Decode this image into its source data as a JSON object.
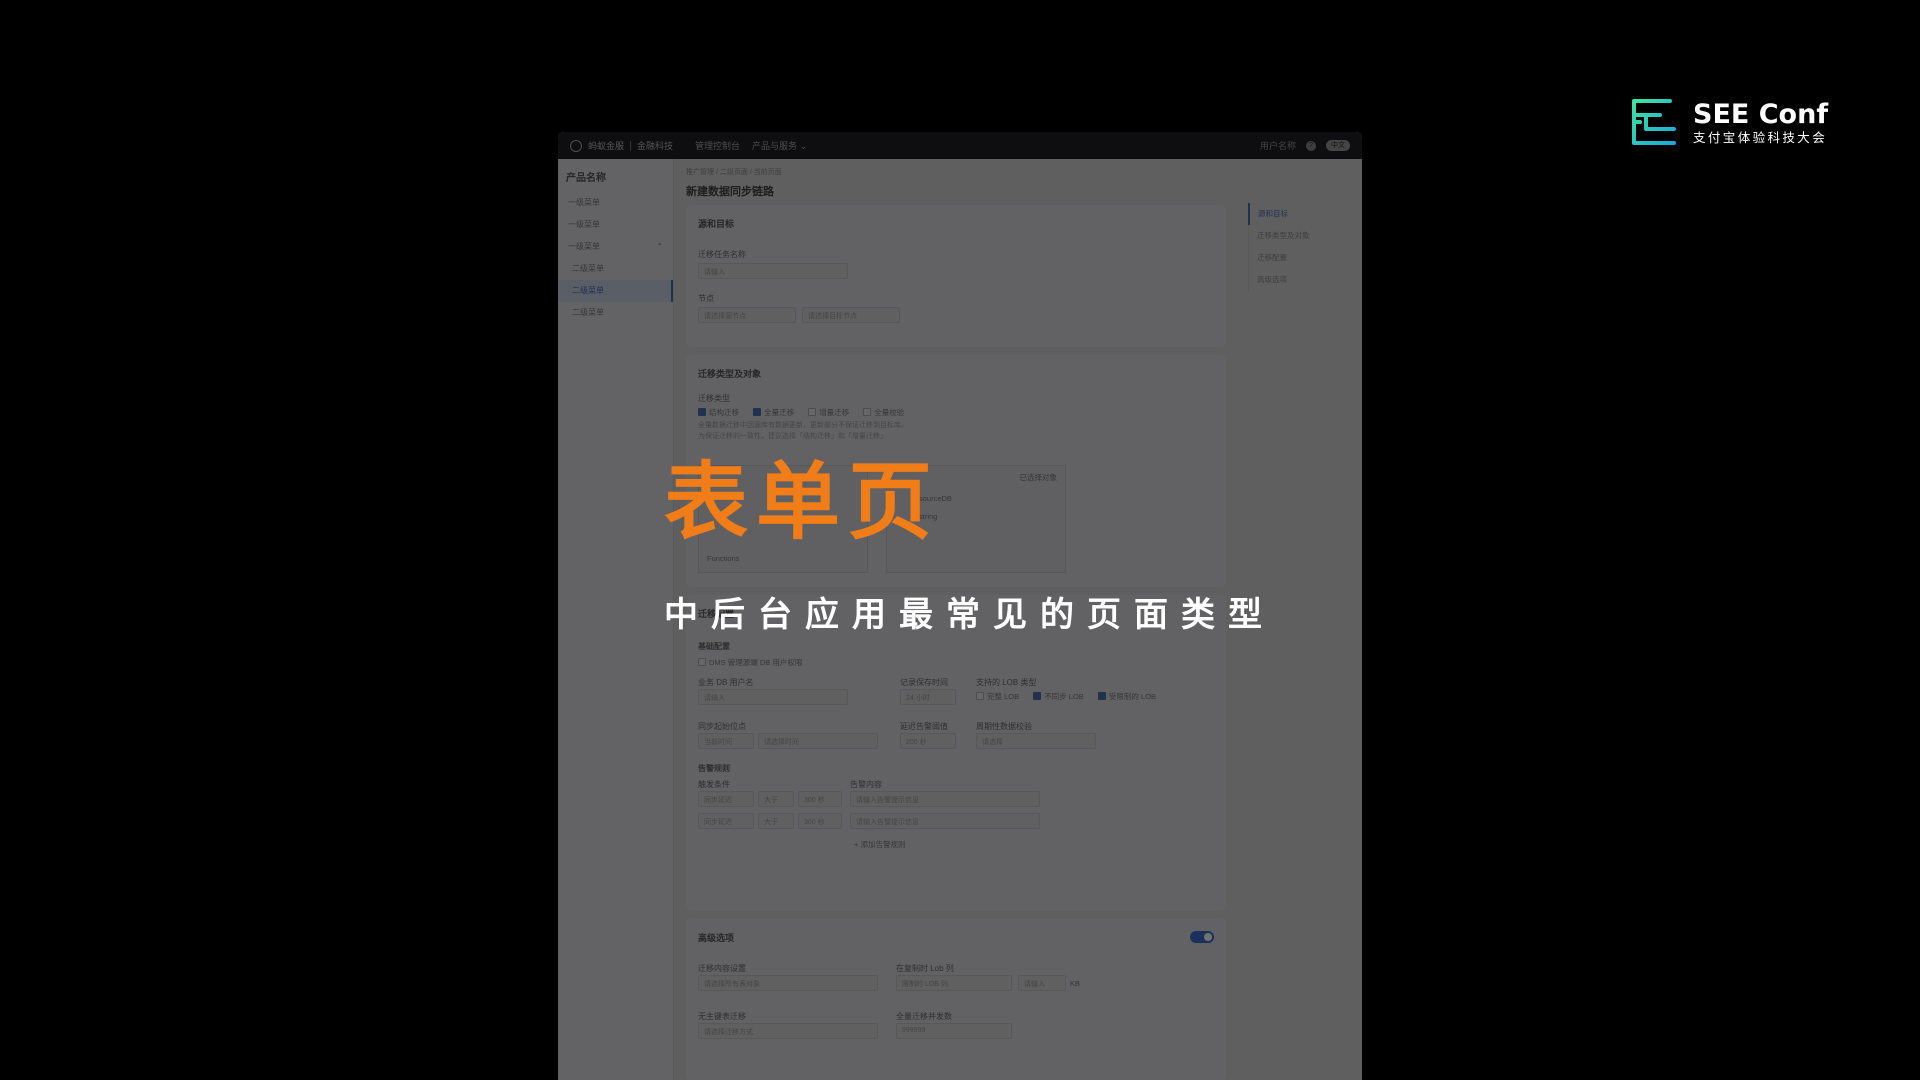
{
  "logo": {
    "title": "SEE Conf",
    "subtitle": "支付宝体验科技大会",
    "mark_color": "#1fd0c1"
  },
  "headline": {
    "title": "表单页",
    "subtitle": "中后台应用最常见的页面类型",
    "title_color": "#f07d17"
  },
  "app": {
    "topbar": {
      "brand_left": "蚂蚁金服",
      "brand_right": "金融科技",
      "nav": [
        "管理控制台",
        "产品与服务"
      ],
      "user": "用户名称",
      "lang": "中文"
    },
    "sidebar": {
      "title": "产品名称",
      "items": [
        {
          "label": "一级菜单"
        },
        {
          "label": "一级菜单"
        },
        {
          "label": "一级菜单"
        },
        {
          "label": "二级菜单"
        },
        {
          "label": "二级菜单"
        },
        {
          "label": "二级菜单"
        }
      ]
    },
    "breadcrumb": "推广管理 / 二级页面 / 当前页面",
    "page_title": "新建数据同步链路",
    "anchors": [
      "源和目标",
      "迁移类型及对象",
      "迁移配置",
      "高级选项"
    ],
    "section_source": {
      "title": "源和目标",
      "task_name_label": "迁移任务名称",
      "task_name_placeholder": "请输入",
      "node_label": "节点",
      "node_placeholder_1": "请选择源节点",
      "node_placeholder_2": "请选择目标节点"
    },
    "section_type": {
      "title": "迁移类型及对象",
      "type_label": "迁移类型",
      "options": [
        "结构迁移",
        "全量迁移",
        "增量迁移",
        "全量校验"
      ],
      "hint_1": "全量数据迁移中因源库有数据更新，更新部分不保证迁移到目标库。",
      "hint_2": "为保证迁移的一致性，建议选择「结构迁移」和「增量迁移」",
      "selected_label": "已选择对象",
      "list_items": [
        "sourceDB",
        "string",
        "Functions"
      ]
    },
    "section_config": {
      "title": "迁移配置",
      "basic_title": "基础配置",
      "dms_label": "DMS 管理源端 DB 用户权限",
      "db_user_label": "业务 DB 用户名",
      "db_user_placeholder": "请输入",
      "log_time_label": "记录保存时间",
      "log_time_value": "24 小时",
      "lob_label": "支持的 LOB 类型",
      "lob_options": [
        "完整 LOB",
        "不同步 LOB",
        "受限制的 LOB"
      ],
      "sync_start_label": "同步起始位点",
      "sync_start_value": "当前时间",
      "sync_start_placeholder": "请选择时间",
      "delay_label": "延迟告警阈值",
      "delay_value": "200 秒",
      "period_label": "周期性数据校验",
      "period_placeholder": "请选择",
      "alarm_title": "告警规则",
      "trigger_label": "触发条件",
      "content_label": "告警内容",
      "rule_metric": "同步延迟",
      "rule_op": "大于",
      "rule_value": "300 秒",
      "rule_content_placeholder": "请输入告警提示信息",
      "add_rule": "+ 添加告警规则"
    },
    "section_advanced": {
      "title": "高级选项",
      "content_label": "迁移内容设置",
      "content_placeholder": "请选择所有表对象",
      "lob_col_label": "在复制时 Lob 列",
      "lob_col_value": "限制的 LOB 列",
      "lob_size_placeholder": "请输入",
      "lob_unit": "KB",
      "nopk_label": "无主键表迁移",
      "nopk_placeholder": "请选择迁移方式",
      "concurrency_label": "全量迁移并发数",
      "concurrency_value": "999999"
    }
  }
}
